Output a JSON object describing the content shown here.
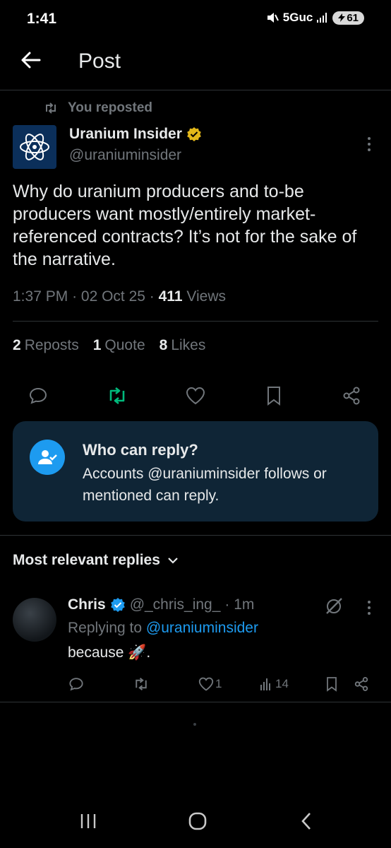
{
  "status": {
    "time": "1:41",
    "network": "5Guc",
    "battery": "61"
  },
  "header": {
    "title": "Post"
  },
  "repost": {
    "label": "You reposted"
  },
  "post": {
    "author_name": "Uranium Insider",
    "author_handle": "@uraniuminsider",
    "text": "Why do uranium producers and to-be producers want mostly/entirely market-referenced contracts? It’s not for the sake of the narrative.",
    "time": "1:37 PM",
    "date": "02 Oct 25",
    "views_count": "411",
    "views_label": "Views",
    "reposts_count": "2",
    "reposts_label": "Reposts",
    "quotes_count": "1",
    "quotes_label": "Quote",
    "likes_count": "8",
    "likes_label": "Likes"
  },
  "who_can_reply": {
    "title": "Who can reply?",
    "description": "Accounts @uraniuminsider follows or mentioned can reply."
  },
  "replies": {
    "sort_label": "Most relevant replies",
    "items": [
      {
        "name": "Chris",
        "handle": "@_chris_ing_",
        "time": "· 1m",
        "replying_prefix": "Replying to",
        "replying_to": "@uraniuminsider",
        "text": "because 🚀.",
        "likes": "1",
        "views": "14"
      }
    ]
  },
  "colors": {
    "accent": "#1d9bf0",
    "repost_active": "#00ba7c",
    "muted": "#71767b",
    "verified_gold": "#e2b719"
  },
  "icons": [
    "back-arrow-icon",
    "repost-icon",
    "reply-icon",
    "like-icon",
    "bookmark-icon",
    "share-icon",
    "verified-icon",
    "more-icon",
    "views-icon",
    "grok-icon"
  ]
}
